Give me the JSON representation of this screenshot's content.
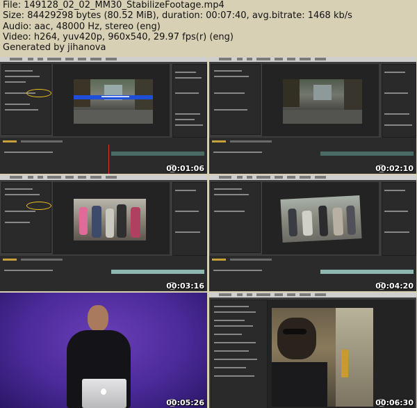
{
  "info": {
    "file": "File: 149128_02_02_MM30_StabilizeFootage.mp4",
    "size": "Size: 84429298 bytes (80.52 MiB), duration: 00:07:40, avg.bitrate: 1468 kb/s",
    "audio": "Audio: aac, 48000 Hz, stereo (eng)",
    "video": "Video: h264, yuv420p, 960x540, 29.97 fps(r) (eng)",
    "generated": "Generated by jihanova"
  },
  "thumbnails": [
    {
      "timestamp": "00:01:06",
      "scene": "after-effects-street-with-label"
    },
    {
      "timestamp": "00:02:10",
      "scene": "after-effects-street"
    },
    {
      "timestamp": "00:03:16",
      "scene": "after-effects-crowd"
    },
    {
      "timestamp": "00:04:20",
      "scene": "after-effects-cyclists"
    },
    {
      "timestamp": "00:05:26",
      "scene": "presenter-on-purple"
    },
    {
      "timestamp": "00:06:30",
      "scene": "after-effects-man-subway"
    }
  ],
  "colors": {
    "background": "#d8d0b4",
    "ae_ui": "#3c3c3c",
    "presenter_bg": "#4b2a9a",
    "highlight_oval": "#f0c020",
    "label_bar": "#1f4fd8"
  }
}
